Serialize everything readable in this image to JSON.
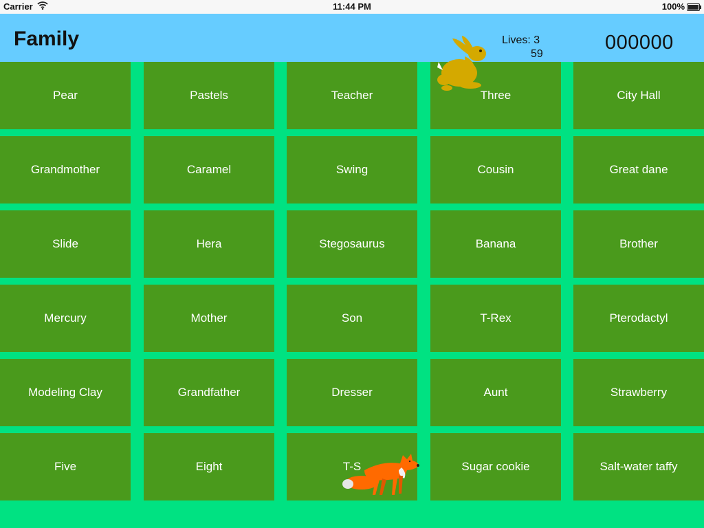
{
  "status": {
    "carrier": "Carrier",
    "time": "11:44 PM",
    "battery": "100%"
  },
  "header": {
    "title": "Family",
    "lives_label": "Lives: 3",
    "timer": "59",
    "score": "000000"
  },
  "grid": [
    [
      "Pear",
      "Pastels",
      "Teacher",
      "Three",
      "City Hall"
    ],
    [
      "Grandmother",
      "Caramel",
      "Swing",
      "Cousin",
      "Great dane"
    ],
    [
      "Slide",
      "Hera",
      "Stegosaurus",
      "Banana",
      "Brother"
    ],
    [
      "Mercury",
      "Mother",
      "Son",
      "T-Rex",
      "Pterodactyl"
    ],
    [
      "Modeling Clay",
      "Grandfather",
      "Dresser",
      "Aunt",
      "Strawberry"
    ],
    [
      "Five",
      "Eight",
      "T-S",
      "Sugar cookie",
      "Salt-water taffy"
    ]
  ],
  "characters": {
    "player": "rabbit-icon",
    "enemy": "fox-icon"
  },
  "colors": {
    "background": "#00e282",
    "header": "#66ccff",
    "tile": "#4a9a1c",
    "tile_text": "#ffffff"
  }
}
